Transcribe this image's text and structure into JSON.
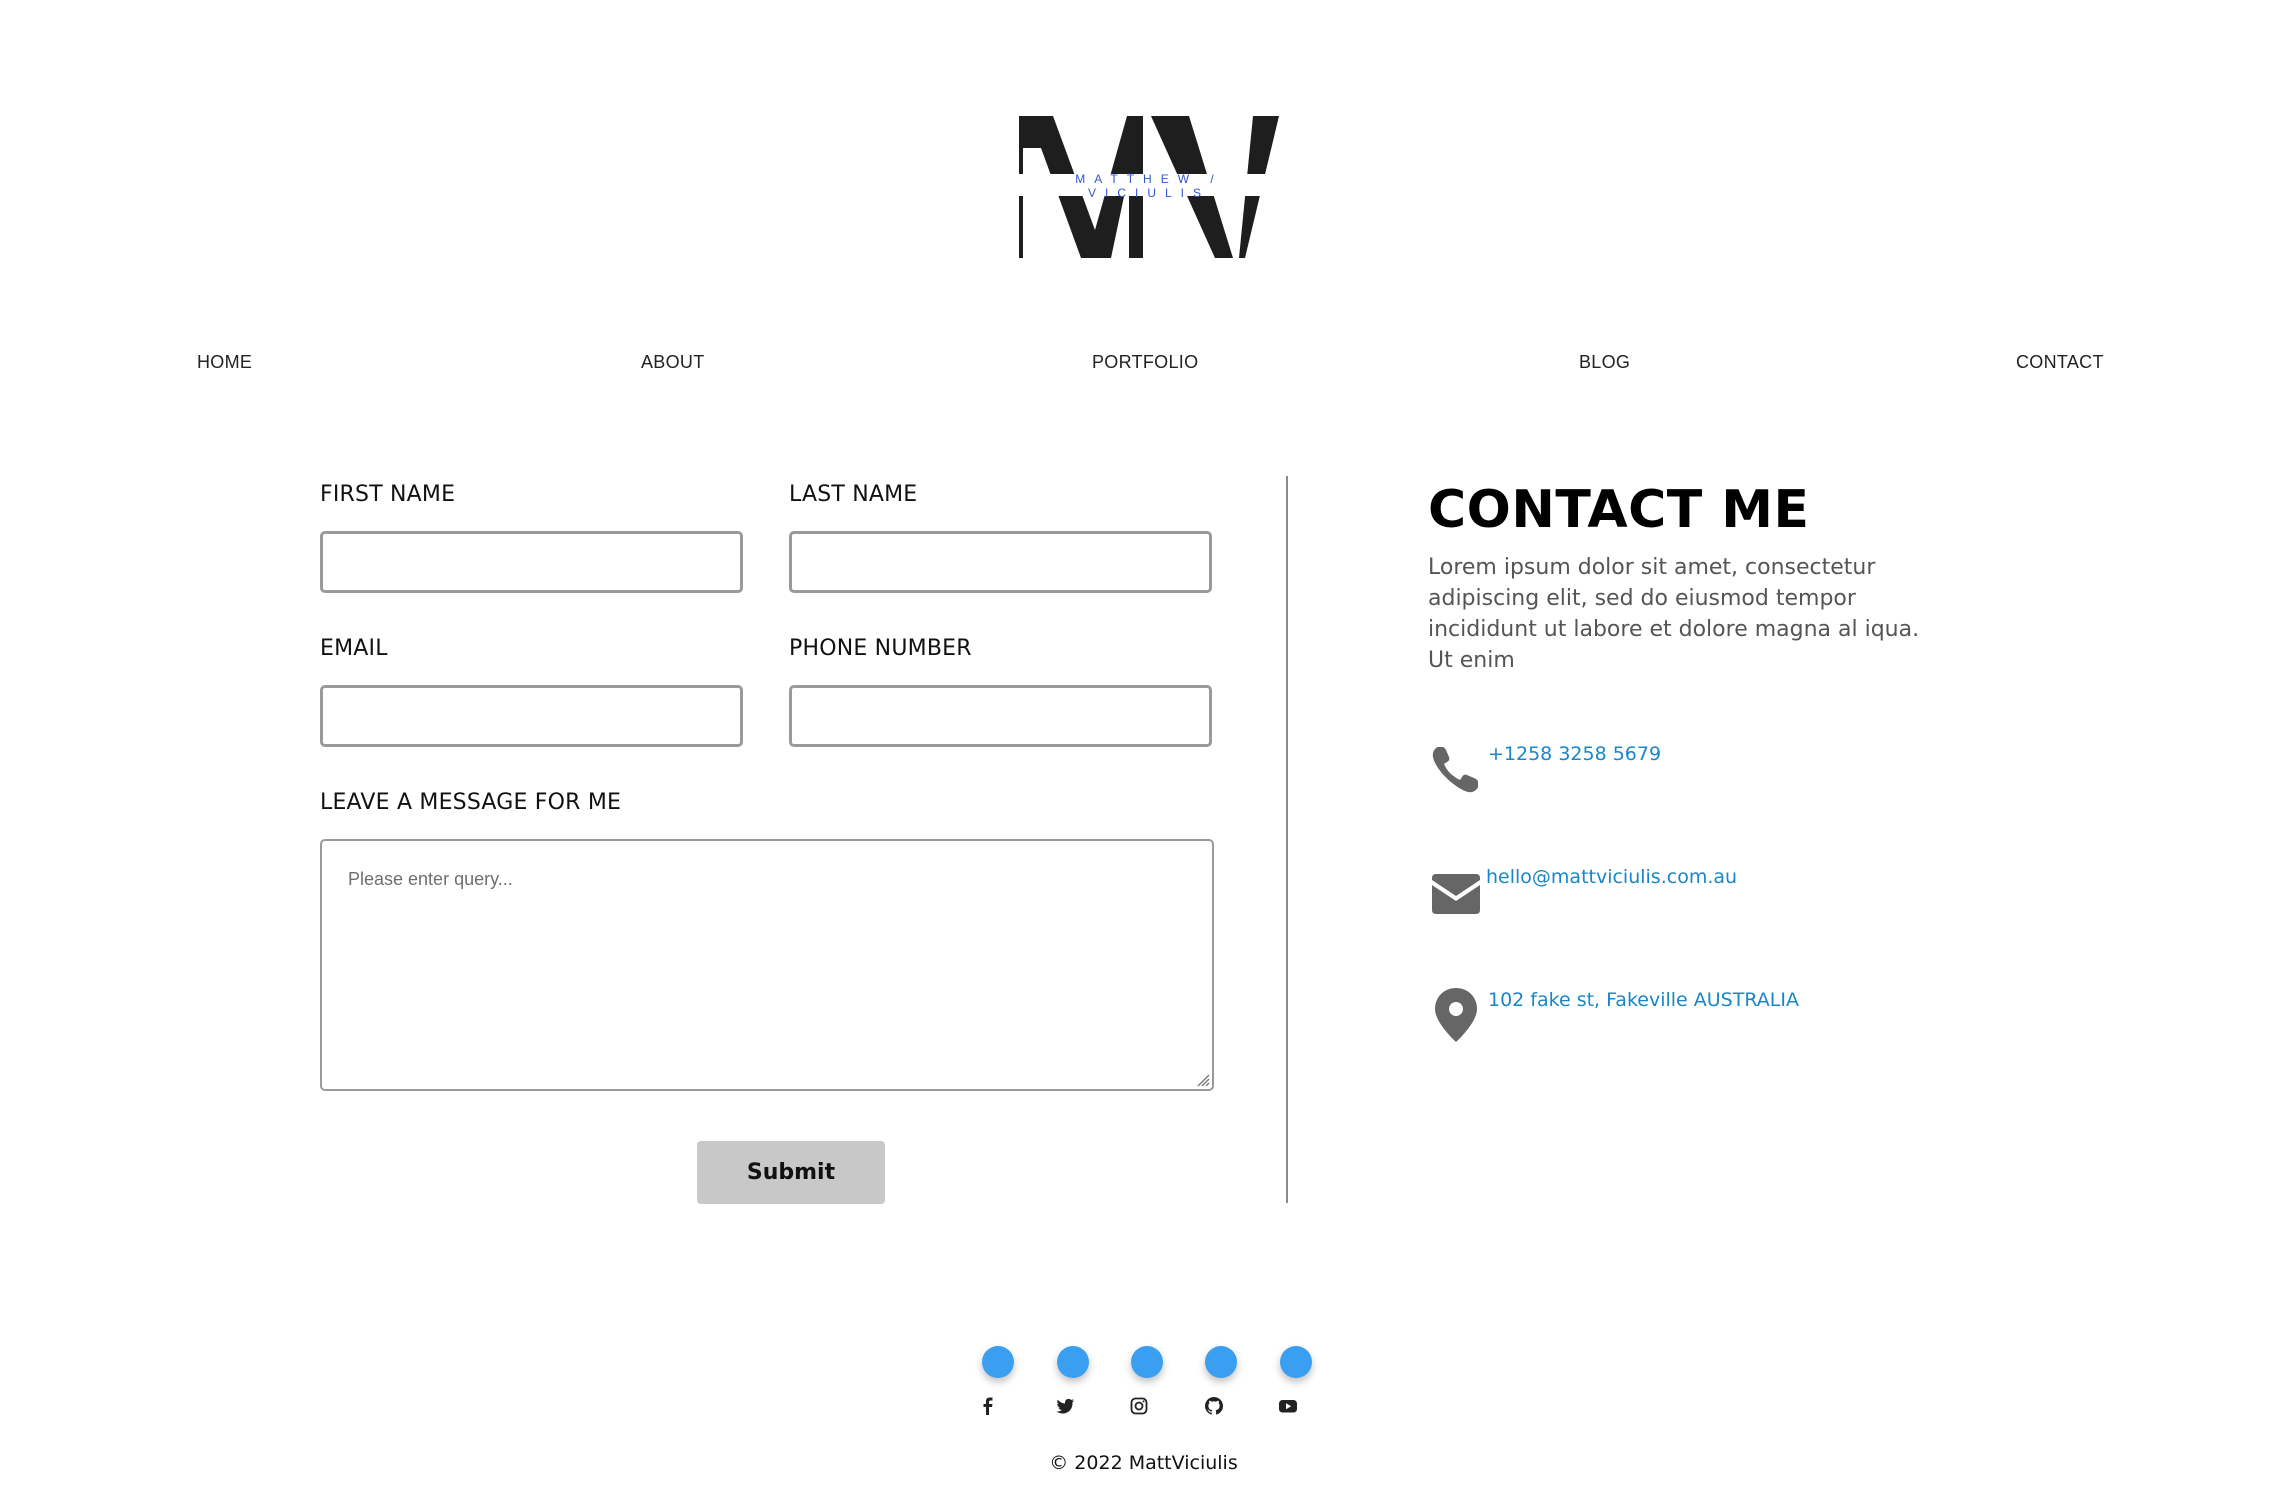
{
  "logo": {
    "letters": "MV",
    "tagline": "MATTHEW / VICIULIS"
  },
  "nav": {
    "items": [
      {
        "label": "HOME"
      },
      {
        "label": "ABOUT"
      },
      {
        "label": "PORTFOLIO"
      },
      {
        "label": "BLOG"
      },
      {
        "label": "CONTACT"
      }
    ]
  },
  "form": {
    "first_name_label": "FIRST NAME",
    "last_name_label": "LAST NAME",
    "email_label": "EMAIL",
    "phone_label": "PHONE NUMBER",
    "message_label": "LEAVE A MESSAGE FOR ME",
    "first_name_value": "",
    "last_name_value": "",
    "email_value": "",
    "phone_value": "",
    "message_placeholder": "Please enter query...",
    "submit_label": "Submit"
  },
  "contact": {
    "title": "CONTACT ME",
    "description": "Lorem ipsum dolor sit amet, consectetur adipiscing elit, sed do eiusmod tempor incididunt ut labore et dolore magna al iqua. Ut enim",
    "phone": "+1258 3258 5679",
    "email": "hello@mattviciulis.com.au",
    "address": "102 fake st, Fakeville AUSTRALIA",
    "icon_color": "#666666",
    "link_color": "#1a86c6"
  },
  "footer": {
    "social_icons": [
      "facebook-icon",
      "twitter-icon",
      "instagram-icon",
      "github-icon",
      "youtube-icon"
    ],
    "dot_color": "#3a9ff0",
    "copyright": "© 2022 MattViciulis"
  }
}
